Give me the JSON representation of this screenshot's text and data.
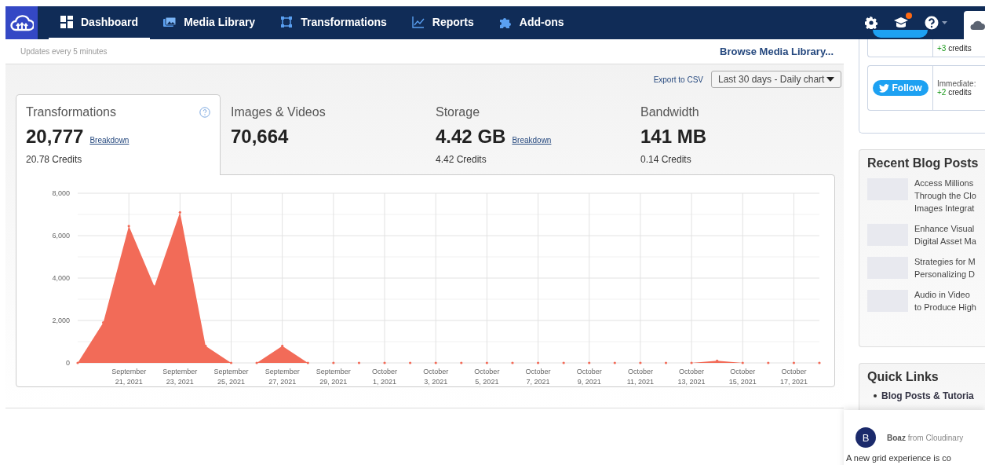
{
  "nav": {
    "items": [
      {
        "label": "Dashboard",
        "selected": true
      },
      {
        "label": "Media Library",
        "selected": false
      },
      {
        "label": "Transformations",
        "selected": false
      },
      {
        "label": "Reports",
        "selected": false
      },
      {
        "label": "Add-ons",
        "selected": false
      }
    ],
    "updates_badge": true
  },
  "header": {
    "updates_note": "Updates every 5 minutes",
    "browse_link": "Browse Media Library..."
  },
  "controls": {
    "export_link": "Export to CSV",
    "period": "Last 30 days - Daily chart"
  },
  "tabs": [
    {
      "title": "Transformations",
      "value": "20,777",
      "breakdown": "Breakdown",
      "credits": "20.78 Credits",
      "selected": true,
      "help": true
    },
    {
      "title": "Images & Videos",
      "value": "70,664",
      "selected": false
    },
    {
      "title": "Storage",
      "value": "4.42 GB",
      "breakdown": "Breakdown",
      "credits": "4.42 Credits",
      "selected": false
    },
    {
      "title": "Bandwidth",
      "value": "141 MB",
      "credits": "0.14 Credits",
      "selected": false
    }
  ],
  "chart_data": {
    "type": "area",
    "categories": [
      null,
      null,
      "September 21, 2021",
      null,
      "September 23, 2021",
      null,
      "September 25, 2021",
      null,
      "September 27, 2021",
      null,
      "September 29, 2021",
      null,
      "October 1, 2021",
      null,
      "October 3, 2021",
      null,
      "October 5, 2021",
      null,
      "October 7, 2021",
      null,
      "October 9, 2021",
      null,
      "October 11, 2021",
      null,
      "October 13, 2021",
      null,
      "October 15, 2021",
      null,
      "October 17, 2021",
      null
    ],
    "grid": true,
    "series": [
      {
        "color": "#f26b58",
        "values": [
          0,
          1900,
          6450,
          3600,
          7100,
          800,
          0,
          0,
          800,
          0,
          0,
          0,
          0,
          0,
          0,
          0,
          0,
          0,
          0,
          0,
          0,
          0,
          0,
          0,
          0,
          100,
          0,
          0,
          0,
          0
        ]
      }
    ],
    "ylim": [
      0,
      8000
    ],
    "yticks": [
      {
        "value": 0,
        "label": "0"
      },
      {
        "value": 2000,
        "label": "2,000"
      },
      {
        "value": 4000,
        "label": "4,000"
      },
      {
        "value": 6000,
        "label": "6,000"
      },
      {
        "value": 8000,
        "label": "8,000"
      }
    ]
  },
  "social": {
    "tweet_credits_plus": "+3",
    "tweet_credits": "credits",
    "follow_button": "Follow",
    "follow_note": "Immediate:",
    "follow_credits_plus": "+2",
    "follow_credits": "credits"
  },
  "blog": {
    "title": "Recent Blog Posts",
    "posts": [
      {
        "title_lines": [
          "Access Millions",
          "Through the Clo",
          "Images Integrat"
        ]
      },
      {
        "title_lines": [
          "Enhance Visual",
          "Digital Asset Ma"
        ]
      },
      {
        "title_lines": [
          "Strategies for M",
          "Personalizing D"
        ]
      },
      {
        "title_lines": [
          "Audio in Video",
          "to Produce High"
        ]
      }
    ]
  },
  "quick_links": {
    "title": "Quick Links",
    "items": [
      "Blog Posts & Tutoria"
    ]
  },
  "chat": {
    "avatar": "B",
    "sender": "**Boaz** from Cloudinary",
    "message": "A new grid experience is co"
  }
}
